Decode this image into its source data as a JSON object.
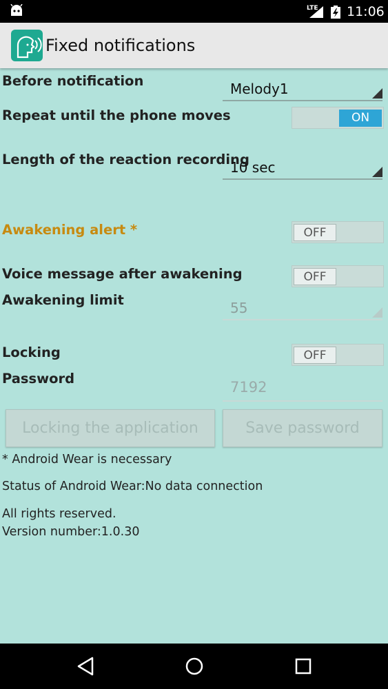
{
  "status_bar": {
    "network": "LTE",
    "time": "11:06"
  },
  "app_bar": {
    "title": "Fixed notifications",
    "icon": "app-face-sound-icon"
  },
  "settings": {
    "before_notification": {
      "label": "Before notification",
      "value": "Melody1"
    },
    "repeat_until_moves": {
      "label": "Repeat until the phone moves",
      "state": "ON"
    },
    "reaction_length": {
      "label": "Length of the reaction recording",
      "value": "10 sec"
    },
    "awakening_alert": {
      "label": "Awakening alert *",
      "state": "OFF"
    },
    "voice_after_awakening": {
      "label": "Voice message after awakening",
      "state": "OFF"
    },
    "awakening_limit": {
      "label": "Awakening limit",
      "value": "55"
    },
    "locking": {
      "label": "Locking",
      "state": "OFF"
    },
    "password": {
      "label": "Password",
      "value": "7192"
    }
  },
  "buttons": {
    "lock_app": "Locking the application",
    "save_password": "Save password"
  },
  "info": {
    "wear_note": "* Android Wear is necessary",
    "wear_status": "Status of Android Wear:No data connection",
    "rights": "All rights reserved.",
    "version": "Version number:1.0.30"
  },
  "colors": {
    "accent_orange": "#c78a10",
    "toggle_on": "#2ea5d6",
    "background": "#b2e2db",
    "app_icon": "#1ea991"
  }
}
